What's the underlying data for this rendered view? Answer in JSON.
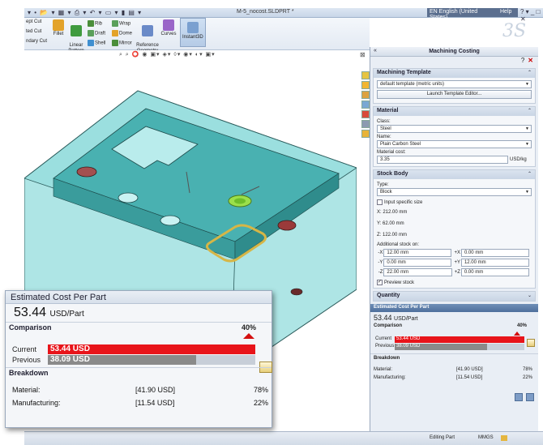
{
  "titlebar": {
    "quick_access": "▾ • 📂 ▾ ▦ ▾ ⎙ ▾ ↶ ▾ ▭ ▾ ▮ ▤ ▾",
    "document_title": "M-5_nocost.SLDPRT *",
    "language": "EN English (United States)",
    "help": "Help",
    "controls": "? ▾  _  □  ✕"
  },
  "ribbon": {
    "left_items": [
      "ept Cut",
      "ted Cut",
      "ndary Cut"
    ],
    "fillet": "Fillet",
    "linear_pattern": "Linear\nPattern",
    "rib": "Rib",
    "draft": "Draft",
    "shell": "Shell",
    "wrap": "Wrap",
    "dome": "Dome",
    "mirror": "Mirror",
    "reference_geometry": "Reference\nGeometry",
    "curves": "Curves",
    "instant3d": "Instant3D"
  },
  "view_toolbar": "⌕ ⌕ ⭕ ◉ ▣▾ ◈▾ ◊▾ ◉▾ ◐▾ ▣▾",
  "panel": {
    "title": "Machining Costing",
    "machining_template": {
      "header": "Machining Template",
      "value": "default template (metric units)",
      "launch_button": "Launch Template Editor..."
    },
    "material": {
      "header": "Material",
      "class_label": "Class:",
      "class_value": "Steel",
      "name_label": "Name:",
      "name_value": "Plain Carbon Steel",
      "cost_label": "Material cost:",
      "cost_value": "3.35",
      "cost_unit": "USD/kg"
    },
    "stock_body": {
      "header": "Stock Body",
      "type_label": "Type:",
      "type_value": "Block",
      "input_specific_size": "Input specific size",
      "x": "X: 212.00 mm",
      "y": "Y: 62.00 mm",
      "z": "Z: 122.00 mm",
      "additional_label": "Additional stock on:",
      "axes": [
        {
          "neg_label": "-X",
          "neg_value": "12.00 mm",
          "pos_label": "+X",
          "pos_value": "0.00 mm"
        },
        {
          "neg_label": "-Y",
          "neg_value": "0.00 mm",
          "pos_label": "+Y",
          "pos_value": "12.00 mm"
        },
        {
          "neg_label": "-Z",
          "neg_value": "22.00 mm",
          "pos_label": "+Z",
          "pos_value": "0.00 mm"
        }
      ],
      "preview_stock": "Preview stock"
    },
    "quantity": {
      "header": "Quantity"
    },
    "cost": {
      "header": "Estimated Cost Per Part",
      "value": "53.44",
      "unit": "USD/Part",
      "comparison_label": "Comparison",
      "percent": "40%",
      "current_label": "Current",
      "current_value": "53.44 USD",
      "current_fraction": 1.0,
      "previous_label": "Previous",
      "previous_value": "38.09 USD",
      "previous_fraction": 0.713,
      "breakdown_label": "Breakdown",
      "material_label": "Material:",
      "material_value": "[41.90 USD]",
      "material_pct": "78%",
      "manufacturing_label": "Manufacturing:",
      "manufacturing_value": "[11.54 USD]",
      "manufacturing_pct": "22%"
    }
  },
  "status": {
    "mode": "Editing Part",
    "units": "MMGS"
  },
  "overlay": {
    "title": "Estimated Cost Per Part",
    "value": "53.44",
    "unit": "USD/Part",
    "comparison_label": "Comparison",
    "percent": "40%",
    "current_label": "Current",
    "current_value": "53.44 USD",
    "current_fraction": 1.0,
    "previous_label": "Previous",
    "previous_value": "38.09 USD",
    "previous_fraction": 0.713,
    "breakdown_label": "Breakdown",
    "material_label": "Material:",
    "material_value": "[41.90 USD]",
    "material_pct": "78%",
    "manufacturing_label": "Manufacturing:",
    "manufacturing_value": "[11.54 USD]",
    "manufacturing_pct": "22%"
  },
  "colors": {
    "current_bar": "#e8141a",
    "previous_bar": "#8a8a8a",
    "part_cyan": "#69c9c9",
    "part_dark": "#3f9b9b",
    "highlight_green": "#9be04a",
    "highlight_gold": "#d6b646"
  },
  "icons": [
    "sw-logo-icon",
    "view-toolbar-icons",
    "lock-icon",
    "up-arrow-icon",
    "close-icon",
    "pin-icon"
  ]
}
